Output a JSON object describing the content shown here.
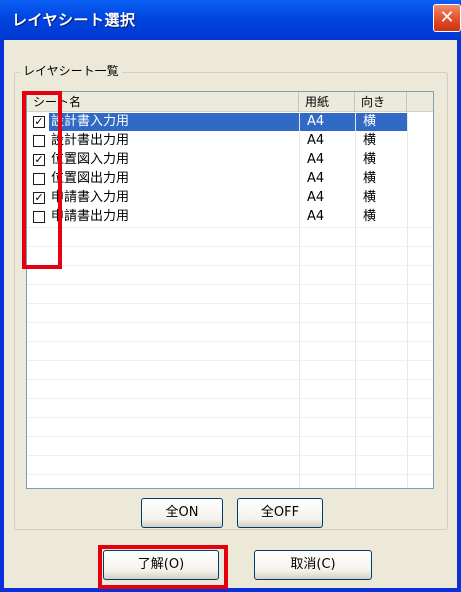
{
  "window": {
    "title": "レイヤシート選択",
    "close_glyph": "✕"
  },
  "group": {
    "label": "レイヤシート一覧"
  },
  "list": {
    "columns": [
      "シート名",
      "用紙",
      "向き"
    ],
    "rows": [
      {
        "checked": true,
        "name": "設計書入力用",
        "paper": "A4",
        "direction": "横",
        "selected": true
      },
      {
        "checked": false,
        "name": "設計書出力用",
        "paper": "A4",
        "direction": "横",
        "selected": false
      },
      {
        "checked": true,
        "name": "位置図入力用",
        "paper": "A4",
        "direction": "横",
        "selected": false
      },
      {
        "checked": false,
        "name": "位置図出力用",
        "paper": "A4",
        "direction": "横",
        "selected": false
      },
      {
        "checked": true,
        "name": "申請書入力用",
        "paper": "A4",
        "direction": "横",
        "selected": false
      },
      {
        "checked": false,
        "name": "申請書出力用",
        "paper": "A4",
        "direction": "横",
        "selected": false
      }
    ]
  },
  "buttons": {
    "all_on": "全ON",
    "all_off": "全OFF",
    "ok": "了解(O)",
    "cancel": "取消(C)"
  },
  "colors": {
    "highlight": "#e4000f",
    "selection": "#316ac5",
    "titlebar": "#0046e0"
  }
}
